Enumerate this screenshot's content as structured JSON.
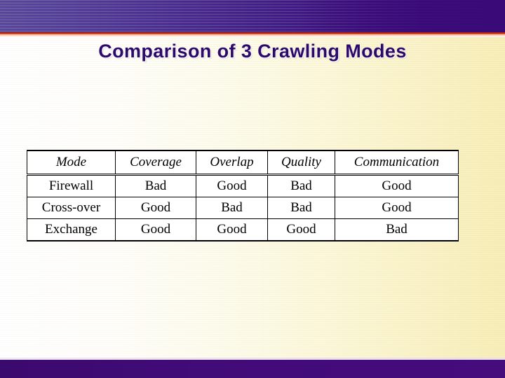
{
  "slide": {
    "title": "Comparison of 3 Crawling Modes",
    "accent_banner_color": "#3a0a78",
    "accent_rule_color": "#c42b15",
    "title_color": "#2b0a6b",
    "footer_color": "#410b78",
    "background_left_color": "#ffffff",
    "background_right_color": "#f8eeb8"
  },
  "table": {
    "headers": [
      "Mode",
      "Coverage",
      "Overlap",
      "Quality",
      "Communication"
    ],
    "rows": [
      {
        "mode": "Firewall",
        "coverage": "Bad",
        "overlap": "Good",
        "quality": "Bad",
        "communication": "Good"
      },
      {
        "mode": "Cross-over",
        "coverage": "Good",
        "overlap": "Bad",
        "quality": "Bad",
        "communication": "Good"
      },
      {
        "mode": "Exchange",
        "coverage": "Good",
        "overlap": "Good",
        "quality": "Good",
        "communication": "Bad"
      }
    ]
  }
}
